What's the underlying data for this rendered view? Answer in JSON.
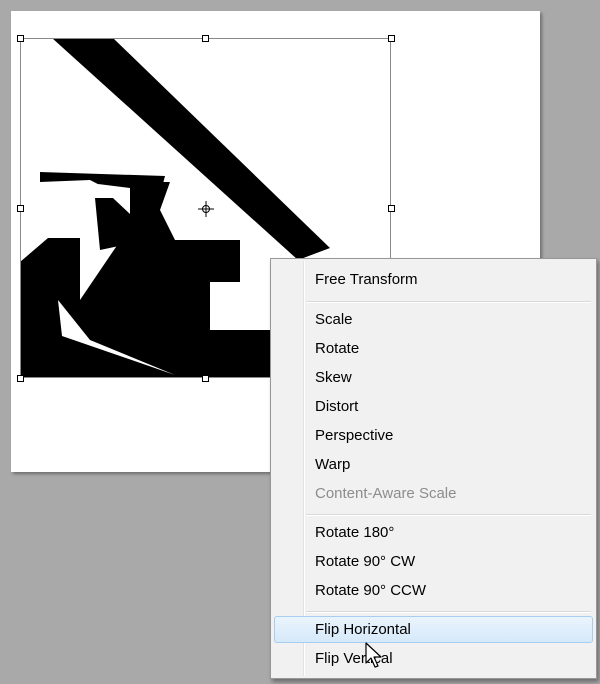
{
  "context_menu": {
    "items": [
      {
        "label": "Free Transform",
        "enabled": true
      },
      {
        "label": "Scale",
        "enabled": true
      },
      {
        "label": "Rotate",
        "enabled": true
      },
      {
        "label": "Skew",
        "enabled": true
      },
      {
        "label": "Distort",
        "enabled": true
      },
      {
        "label": "Perspective",
        "enabled": true
      },
      {
        "label": "Warp",
        "enabled": true
      },
      {
        "label": "Content-Aware Scale",
        "enabled": false
      },
      {
        "label": "Rotate 180°",
        "enabled": true
      },
      {
        "label": "Rotate 90° CW",
        "enabled": true
      },
      {
        "label": "Rotate 90° CCW",
        "enabled": true
      },
      {
        "label": "Flip Horizontal",
        "enabled": true,
        "highlighted": true
      },
      {
        "label": "Flip Vertical",
        "enabled": true
      }
    ]
  },
  "icons": {
    "reference_point": "crosshair-icon",
    "cursor": "arrow-cursor-icon"
  },
  "colors": {
    "artwork": "#000000",
    "document_background": "#ffffff",
    "workspace_background": "#a9a9a9",
    "highlight": "#d6e9fa"
  }
}
